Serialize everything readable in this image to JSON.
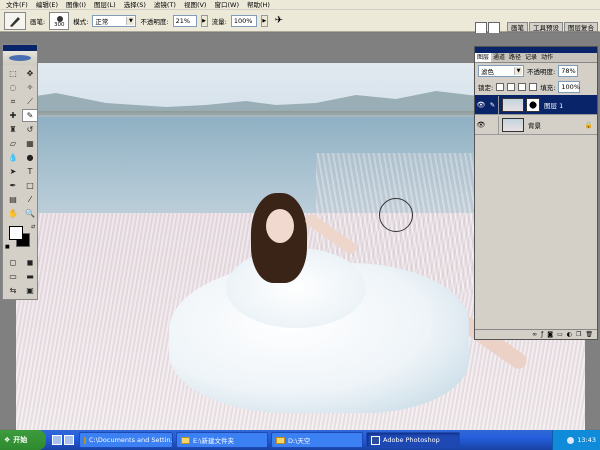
{
  "menu": [
    "文件(F)",
    "编辑(E)",
    "图像(I)",
    "图层(L)",
    "选择(S)",
    "滤镜(T)",
    "视图(V)",
    "窗口(W)",
    "帮助(H)"
  ],
  "options": {
    "brush_label": "画笔:",
    "brush_size": "300",
    "mode_label": "模式:",
    "mode_value": "正常",
    "opacity_label": "不透明度:",
    "opacity_value": "21%",
    "flow_label": "流量:",
    "flow_value": "100%",
    "well_tabs": [
      "画笔",
      "工具预设",
      "图层复合"
    ]
  },
  "layers_panel": {
    "tabs": [
      "图层",
      "通道",
      "路径",
      "记录",
      "动作"
    ],
    "blend_mode": "滤色",
    "opacity_label": "不透明度:",
    "opacity_value": "78%",
    "lock_label": "锁定:",
    "fill_label": "填充:",
    "fill_value": "100%",
    "layers": [
      {
        "name": "图层 1",
        "selected": true,
        "has_mask": true
      },
      {
        "name": "背景",
        "selected": false,
        "locked": true
      }
    ]
  },
  "taskbar": {
    "start_label": "开始",
    "tasks": [
      {
        "label": "C:\\Documents and Settin...",
        "icon": "folder-icon"
      },
      {
        "label": "E:\\新建文件夹",
        "icon": "folder-icon"
      },
      {
        "label": "D:\\天空",
        "icon": "folder-icon"
      },
      {
        "label": "Adobe Photoshop",
        "icon": "photoshop-icon",
        "active": true
      }
    ],
    "clock": "13:43"
  }
}
